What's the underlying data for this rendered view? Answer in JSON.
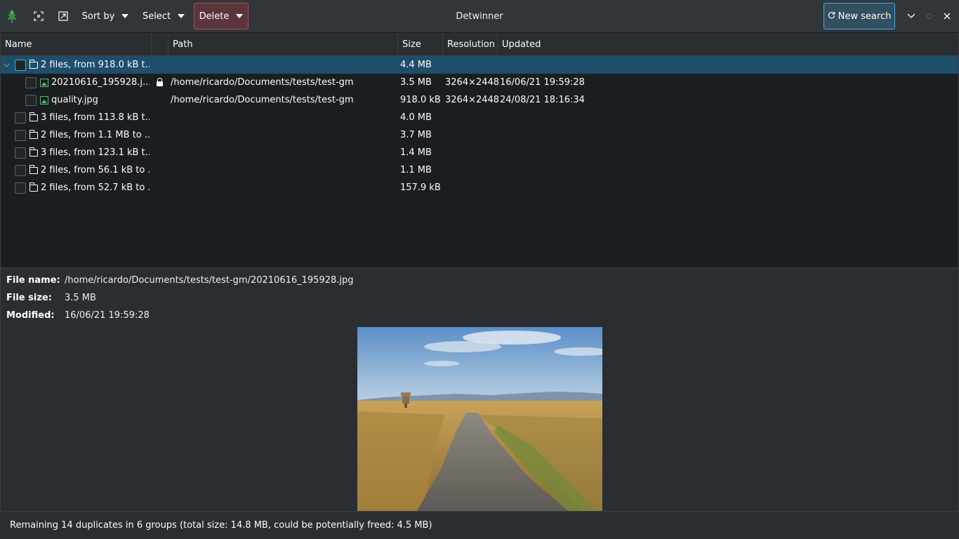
{
  "header": {
    "title": "Detwinner",
    "sort_by_label": "Sort by",
    "select_label": "Select",
    "delete_label": "Delete",
    "new_search_label": "New search"
  },
  "table": {
    "columns": [
      "Name",
      "Path",
      "Size",
      "Resolution",
      "Updated"
    ],
    "rows": [
      {
        "name": "2 files, from 918.0 kB t...",
        "path": "",
        "size": "4.4 MB",
        "resolution": "",
        "updated": ""
      },
      {
        "name": "20210616_195928.j...",
        "path": "/home/ricardo/Documents/tests/test-gm",
        "size": "3.5 MB",
        "resolution": "3264×2448",
        "updated": "16/06/21 19:59:28"
      },
      {
        "name": "quality.jpg",
        "path": "/home/ricardo/Documents/tests/test-gm",
        "size": "918.0 kB",
        "resolution": "3264×2448",
        "updated": "24/08/21 18:16:34"
      },
      {
        "name": "3 files, from 113.8 kB t...",
        "path": "",
        "size": "4.0 MB",
        "resolution": "",
        "updated": ""
      },
      {
        "name": "2 files, from 1.1 MB to ...",
        "path": "",
        "size": "3.7 MB",
        "resolution": "",
        "updated": ""
      },
      {
        "name": "3 files, from 123.1 kB t...",
        "path": "",
        "size": "1.4 MB",
        "resolution": "",
        "updated": ""
      },
      {
        "name": "2 files, from 56.1 kB to ...",
        "path": "",
        "size": "1.1 MB",
        "resolution": "",
        "updated": ""
      },
      {
        "name": "2 files, from 52.7 kB to ...",
        "path": "",
        "size": "157.9 kB",
        "resolution": "",
        "updated": ""
      }
    ]
  },
  "details": {
    "file_name_label": "File name:",
    "file_name_value": "/home/ricardo/Documents/tests/test-gm/20210616_195928.jpg",
    "file_size_label": "File size:",
    "file_size_value": "3.5 MB",
    "modified_label": "Modified:",
    "modified_value": "16/06/21 19:59:28"
  },
  "status": {
    "text": "Remaining 14 duplicates in 6 groups (total size: 14.8 MB, could be potentially freed: 4.5 MB)"
  },
  "colors": {
    "accent": "#3daee9",
    "delete_bg": "#5c353a",
    "selection": "#1d4e6b",
    "image_icon": "#4ec16a"
  }
}
